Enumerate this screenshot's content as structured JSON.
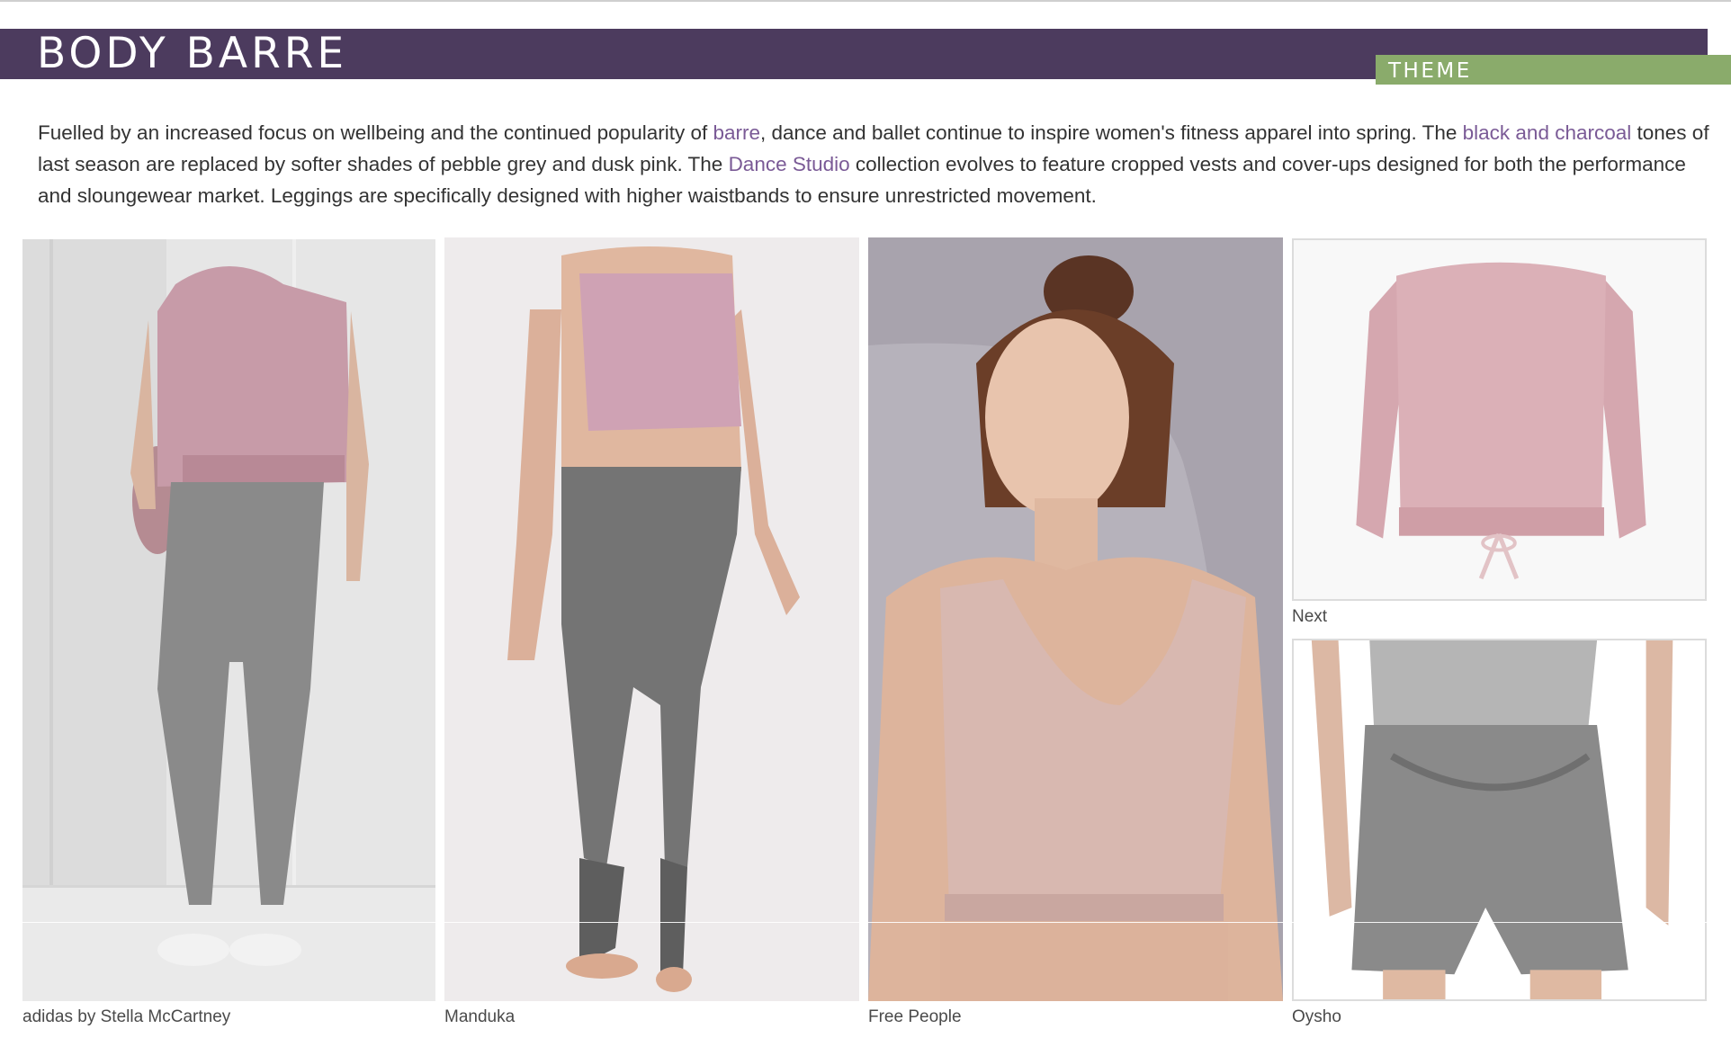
{
  "header": {
    "title": "BODY BARRE",
    "tag": "THEME"
  },
  "intro": {
    "p1": "Fuelled by an increased focus on wellbeing and the continued popularity of ",
    "link1": "barre",
    "p2": ", dance and ballet continue to inspire women's fitness apparel into spring. The ",
    "link2": "black and charcoal",
    "p3": " tones of last season are replaced by softer shades of pebble grey and dusk pink. The ",
    "link3": "Dance Studio",
    "p4": " collection evolves to feature cropped vests and cover-ups designed for both the performance and sloungewear market. Leggings are specifically designed with higher waistbands to ensure unrestricted movement."
  },
  "captions": {
    "adidas": "adidas by Stella McCartney",
    "manduka": "Manduka",
    "freepeople": "Free People",
    "next": "Next",
    "oysho": "Oysho"
  },
  "colors": {
    "header_bar": "#4c3b5e",
    "theme_tag": "#8aab6b",
    "link": "#7a5a96",
    "pink": "#d4a9b6",
    "grey": "#7d7d7d"
  }
}
